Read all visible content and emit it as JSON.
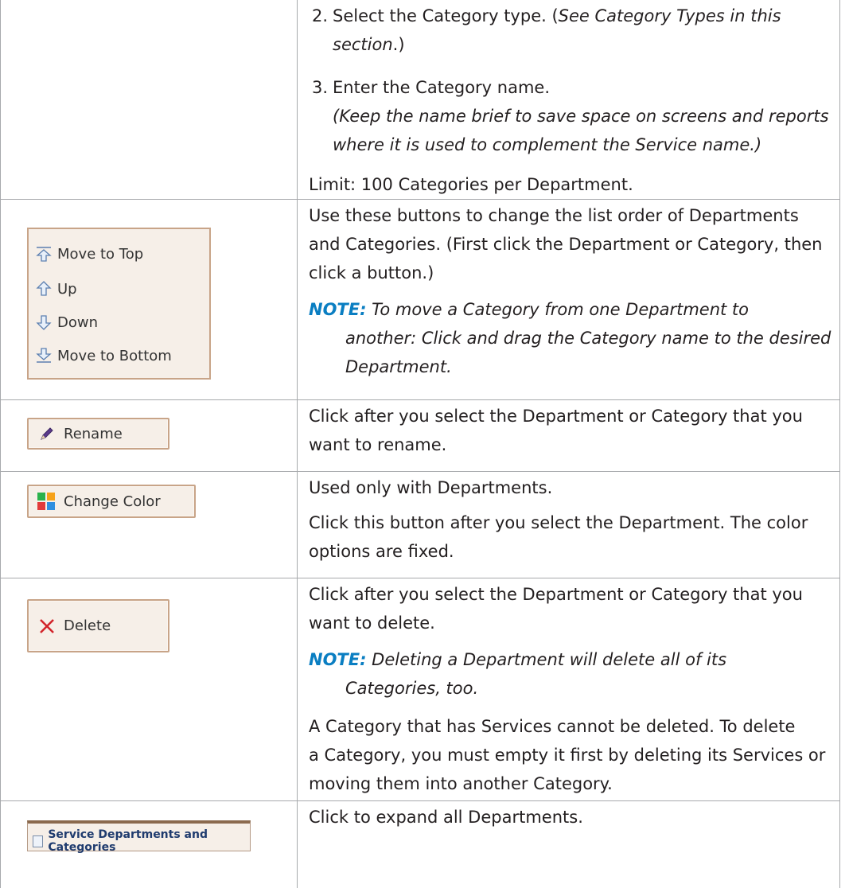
{
  "rows": {
    "r1": {
      "step2_num": "2.",
      "step2_a": "Select the Category type. (",
      "step2_b": "See Category Types in this",
      "step2_c": "section",
      "step2_d": ".)",
      "step3_num": "3.",
      "step3_text": "Enter the Category name.",
      "step3_note_1": "(Keep the name brief to save space on screens and reports",
      "step3_note_2": "where it is used to complement the Service name.)",
      "limit": "Limit: 100 Categories per Department."
    },
    "r2": {
      "move_top": "Move to Top",
      "up": "Up",
      "down": "Down",
      "move_bottom": "Move to Bottom",
      "line1": "Use these buttons to change the list order of Departments",
      "line2": "and Categories. (First click the Department or Category, then",
      "line3": "click a button.)",
      "note_label": "NOTE:",
      "note_1": " To move a Category from one Department to",
      "note_2": "another: Click and drag the Category name to the desired",
      "note_3": "Department."
    },
    "r3": {
      "button": "Rename",
      "line1": "Click after you select the Department or Category that you",
      "line2": "want to rename."
    },
    "r4": {
      "button": "Change Color",
      "line1": "Used only with Departments.",
      "line2": "Click this button after you select the Department. The color",
      "line3": "options are fixed."
    },
    "r5": {
      "button": "Delete",
      "line1": "Click after you select the Department or Category that you",
      "line2": "want to delete.",
      "note_label": "NOTE:",
      "note_1": " Deleting a Department will delete all of its",
      "note_2": "Categories, too.",
      "para_1": "A Category that has Services cannot be deleted. To delete",
      "para_2": "a Category, you must empty it first by deleting its Services or",
      "para_3": "moving them into another Category."
    },
    "r6": {
      "button": "Service Departments and Categories",
      "line1": "Click to expand all Departments."
    }
  },
  "colors": {
    "note": "#0a7ec2",
    "button_bg": "#f6efe8",
    "button_border": "#c8a488",
    "delete_x": "#d2232a"
  },
  "icons": [
    "move-to-top-icon",
    "up-arrow-icon",
    "down-arrow-icon",
    "move-to-bottom-icon",
    "pencil-icon",
    "color-grid-icon",
    "close-x-icon",
    "checkbox-icon"
  ]
}
